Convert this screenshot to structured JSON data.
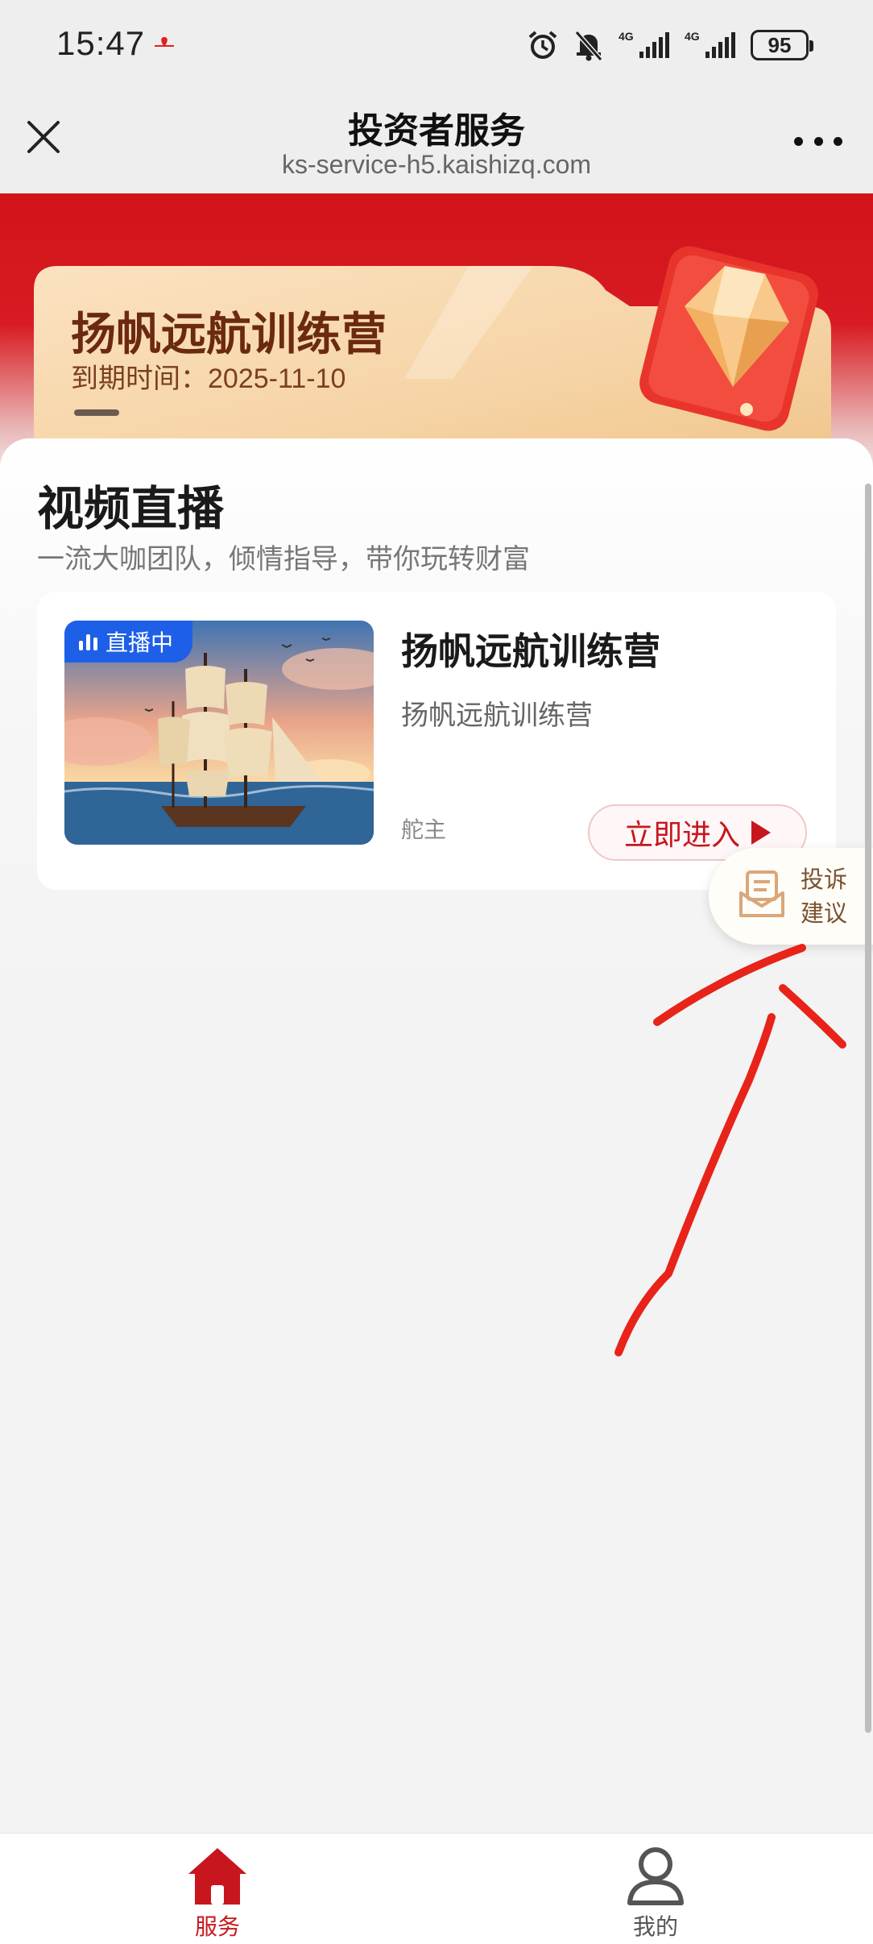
{
  "status_bar": {
    "time": "15:47",
    "battery": "95",
    "network_1": "4G",
    "network_2": "4G"
  },
  "title_bar": {
    "title": "投资者服务",
    "url": "ks-service-h5.kaishizq.com"
  },
  "course": {
    "title": "扬帆远航训练营",
    "expiry_label": "到期时间：",
    "expiry_date": "2025-11-10"
  },
  "live_section": {
    "title": "视频直播",
    "subtitle": "一流大咖团队，倾情指导，带你玩转财富",
    "card": {
      "badge": "直播中",
      "title": "扬帆远航训练营",
      "description": "扬帆远航训练营",
      "host": "舵主",
      "enter_label": "立即进入"
    }
  },
  "complaint": {
    "line1": "投诉",
    "line2": "建议"
  },
  "bottom_nav": {
    "items": [
      {
        "label": "服务",
        "icon": "home-icon",
        "active": true
      },
      {
        "label": "我的",
        "icon": "user-icon",
        "active": false
      }
    ]
  },
  "colors": {
    "brand_red": "#c8161e",
    "hero_red": "#d81b22",
    "live_badge_blue": "#1e5fe8",
    "annotation_red": "#e8231a"
  }
}
